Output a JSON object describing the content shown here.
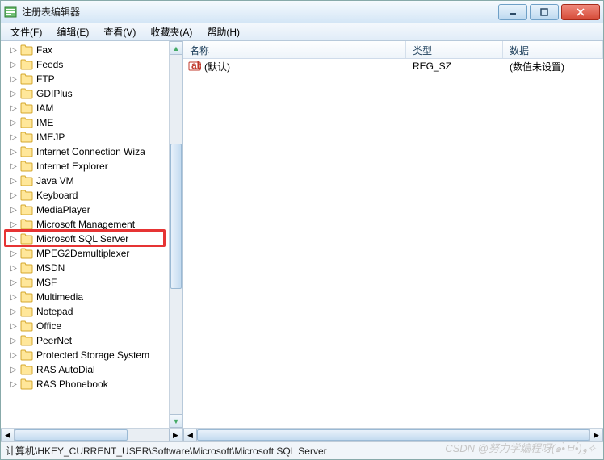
{
  "window": {
    "title": "注册表编辑器"
  },
  "menu": {
    "file": "文件(F)",
    "edit": "编辑(E)",
    "view": "查看(V)",
    "favorites": "收藏夹(A)",
    "help": "帮助(H)"
  },
  "tree": {
    "items": [
      "Fax",
      "Feeds",
      "FTP",
      "GDIPlus",
      "IAM",
      "IME",
      "IMEJP",
      "Internet Connection Wiza",
      "Internet Explorer",
      "Java VM",
      "Keyboard",
      "MediaPlayer",
      "Microsoft Management",
      "Microsoft SQL Server",
      "MPEG2Demultiplexer",
      "MSDN",
      "MSF",
      "Multimedia",
      "Notepad",
      "Office",
      "PeerNet",
      "Protected Storage System",
      "RAS AutoDial",
      "RAS Phonebook"
    ],
    "highlighted_index": 13
  },
  "list": {
    "columns": {
      "name": "名称",
      "type": "类型",
      "data": "数据"
    },
    "rows": [
      {
        "name": "(默认)",
        "type": "REG_SZ",
        "data": "(数值未设置)"
      }
    ]
  },
  "statusbar": {
    "path": "计算机\\HKEY_CURRENT_USER\\Software\\Microsoft\\Microsoft SQL Server"
  },
  "watermark": "CSDN @努力学编程呀(๑•̀ㅂ•́)و✧"
}
